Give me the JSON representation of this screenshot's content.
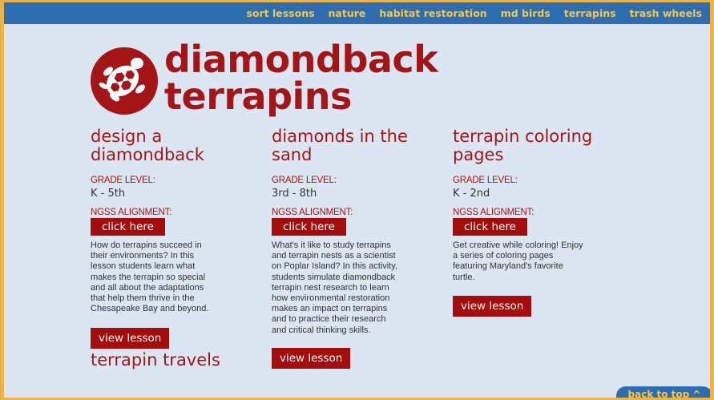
{
  "nav": {
    "items": [
      {
        "label": "sort lessons"
      },
      {
        "label": "nature"
      },
      {
        "label": "habitat restoration"
      },
      {
        "label": "md birds"
      },
      {
        "label": "terrapins"
      },
      {
        "label": "trash wheels"
      }
    ]
  },
  "hero": {
    "title_line1": "diamondback",
    "title_line2": "terrapins"
  },
  "lessons": [
    {
      "title_line1": "design a",
      "title_line2": "diamondback",
      "grade_label": "GRADE LEVEL:",
      "grade": "K - 5th",
      "ngss_label": "NGSS ALIGNMENT:",
      "click_label": "click here",
      "desc_lines": [
        "How do terrapins succeed in",
        "their environments? In this",
        "lesson students learn what",
        "makes the terrapin so special",
        "and all about the adaptations",
        "that help them thrive in the",
        "Chesapeake Bay and beyond."
      ],
      "view_label": "view lesson"
    },
    {
      "title_line1": "diamonds in the",
      "title_line2": "sand",
      "grade_label": "GRADE LEVEL:",
      "grade": "3rd - 8th",
      "ngss_label": "NGSS ALIGNMENT:",
      "click_label": "click here",
      "desc_lines": [
        "What's it like to study terrapins",
        "and terrapin nests as a scientist",
        "on Poplar Island? In this activity,",
        "students simulate diamondback",
        "terrapin nest research to learn",
        "how environmental restoration",
        "makes an impact on terrapins",
        "and to practice their research",
        "and critical thinking skills."
      ],
      "view_label": "view lesson"
    },
    {
      "title_line1": "terrapin coloring",
      "title_line2": "pages",
      "grade_label": "GRADE LEVEL:",
      "grade": "K - 2nd",
      "ngss_label": "NGSS ALIGNMENT:",
      "click_label": "click here",
      "desc_lines": [
        "Get creative while coloring! Enjoy",
        "a series of coloring pages",
        "featuring Maryland's favorite",
        "turtle."
      ],
      "view_label": "view lesson"
    }
  ],
  "next_lesson_title": "terrapin travels",
  "back_to_top_label": "back to top ^",
  "colors": {
    "accent_red": "#a31516",
    "nav_blue": "#2f6db1",
    "nav_text": "#f2c64b",
    "page_bg": "#dbe6f2",
    "frame": "#e9b54a"
  },
  "icons": {
    "logo": "terrapin-logo-icon"
  }
}
